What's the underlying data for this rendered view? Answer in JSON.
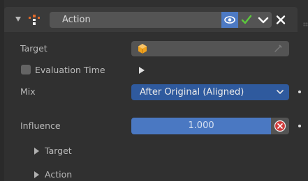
{
  "header": {
    "name_value": "Action"
  },
  "fields": {
    "target_label": "Target",
    "evaluation_time_label": "Evaluation Time",
    "mix_label": "Mix",
    "mix_value": "After Original (Aligned)",
    "influence_label": "Influence",
    "influence_value": "1.000"
  },
  "subpanels": [
    {
      "label": "Target"
    },
    {
      "label": "Action"
    }
  ],
  "icons": {
    "collapse": "chevron-down-icon",
    "constraint": "action-constraint-icon",
    "visibility": "eye-icon",
    "enabled": "checkmark-icon",
    "menu": "chevron-down-icon",
    "delete": "close-icon",
    "target_object": "cube-icon",
    "eyedropper": "eyedropper-icon",
    "reset": "reset-x-icon"
  },
  "colors": {
    "accent_blue": "#4a78c2",
    "dropdown_blue": "#2f5a9e",
    "check_green": "#5cc83c",
    "reset_red": "#d03a3a",
    "cube_orange": "#f0a21e"
  }
}
